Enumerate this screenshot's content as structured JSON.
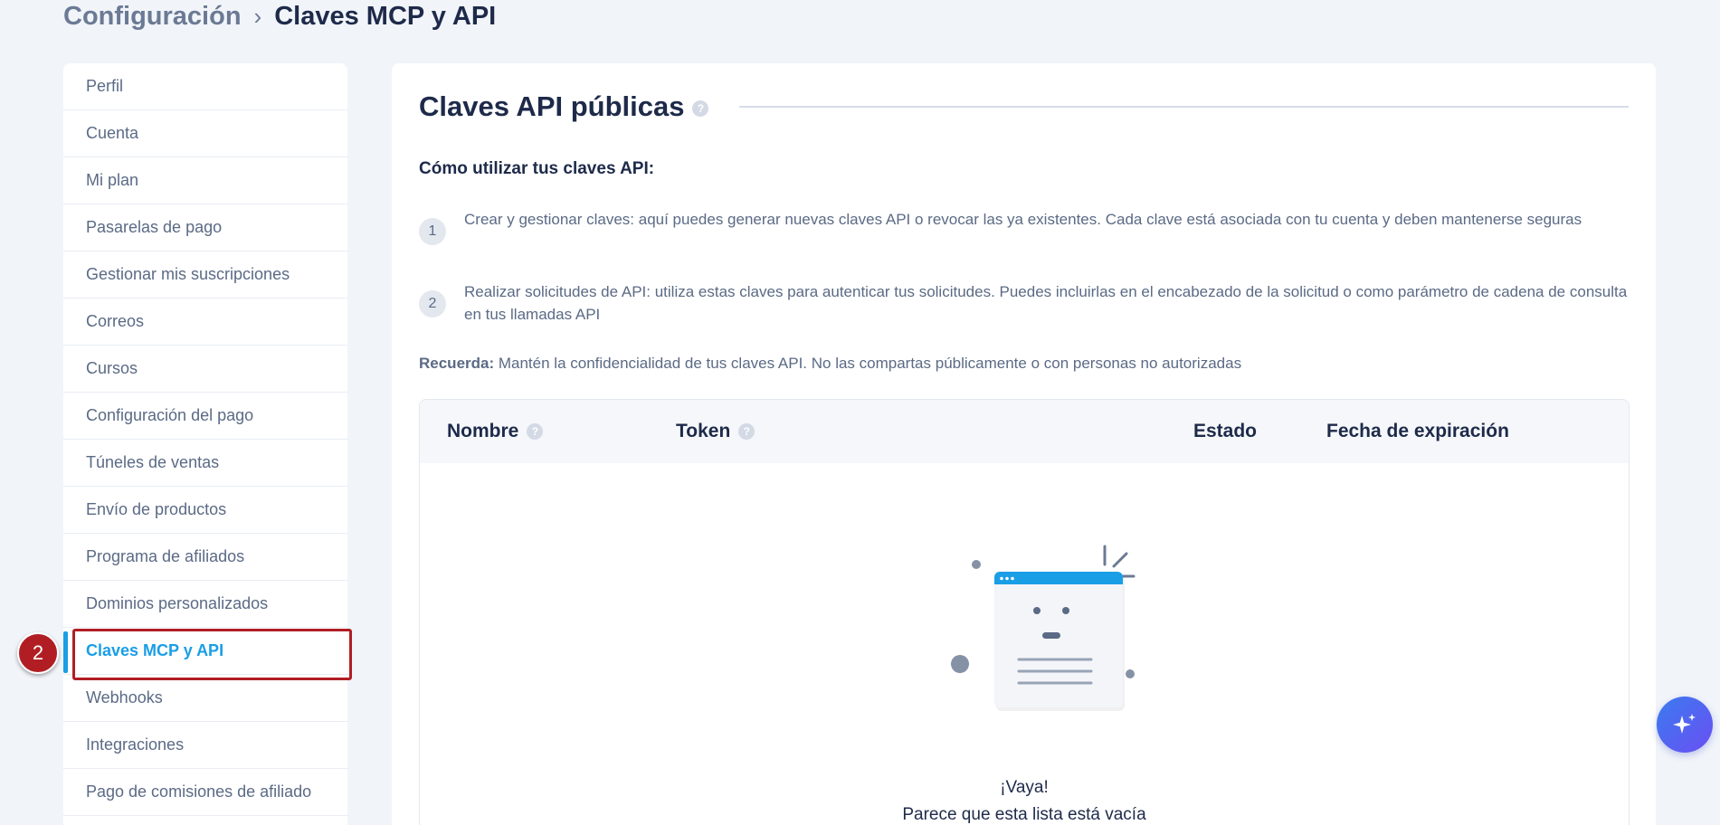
{
  "breadcrumb": {
    "parent": "Configuración",
    "separator": "›",
    "current": "Claves MCP y API"
  },
  "sidebar": {
    "items": [
      {
        "label": "Perfil"
      },
      {
        "label": "Cuenta"
      },
      {
        "label": "Mi plan"
      },
      {
        "label": "Pasarelas de pago"
      },
      {
        "label": "Gestionar mis suscripciones"
      },
      {
        "label": "Correos"
      },
      {
        "label": "Cursos"
      },
      {
        "label": "Configuración del pago"
      },
      {
        "label": "Túneles de ventas"
      },
      {
        "label": "Envío de productos"
      },
      {
        "label": "Programa de afiliados"
      },
      {
        "label": "Dominios personalizados"
      },
      {
        "label": "Claves MCP y API",
        "active": true
      },
      {
        "label": "Webhooks"
      },
      {
        "label": "Integraciones"
      },
      {
        "label": "Pago de comisiones de afiliado"
      }
    ],
    "step_badge": "2"
  },
  "main": {
    "title": "Claves API públicas",
    "help_icon": "?",
    "how_heading": "Cómo utilizar tus claves API:",
    "steps": [
      {
        "num": "1",
        "text": "Crear y gestionar claves: aquí puedes generar nuevas claves API o revocar las ya existentes. Cada clave está asociada con tu cuenta y deben mantenerse seguras"
      },
      {
        "num": "2",
        "text": "Realizar solicitudes de API: utiliza estas claves para autenticar tus solicitudes. Puedes incluirlas en el encabezado de la solicitud o como parámetro de cadena de consulta en tus llamadas API"
      }
    ],
    "remember_label": "Recuerda:",
    "remember_text": " Mantén la confidencialidad de tus claves API. No las compartas públicamente o con personas no autorizadas",
    "table": {
      "columns": [
        "Nombre",
        "Token",
        "Estado",
        "Fecha de expiración"
      ],
      "empty_title": "¡Vaya!",
      "empty_subtitle": "Parece que esta lista está vacía"
    }
  },
  "colors": {
    "accent": "#1a9ee6",
    "highlight": "#b01e24",
    "text_dark": "#1e2a4a",
    "text_muted": "#5b6a85",
    "background": "#f1f4f9"
  },
  "icons": {
    "fab": "sparkles-icon",
    "help": "question-icon",
    "empty": "empty-list-illustration"
  }
}
